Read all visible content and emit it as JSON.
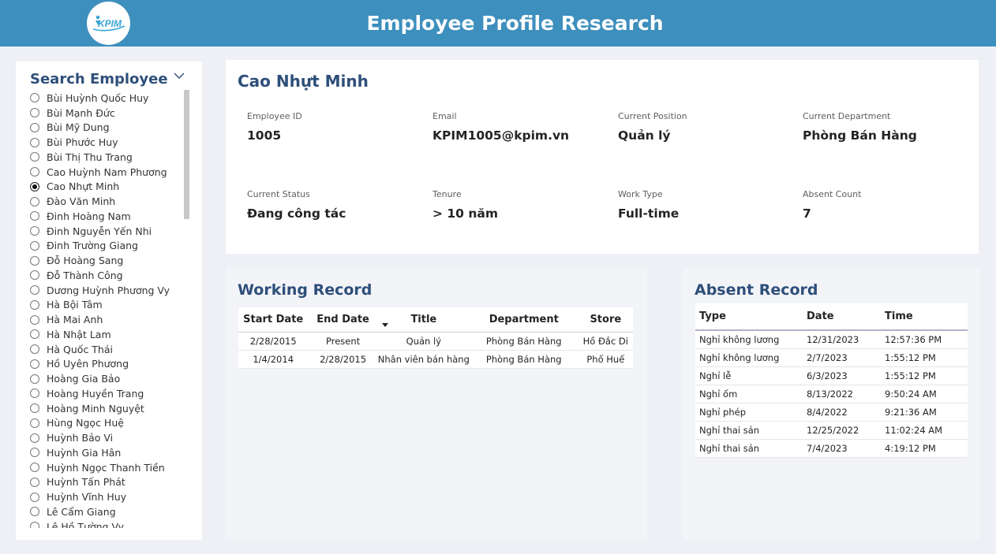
{
  "header": {
    "title": "Employee Profile Research",
    "logo_text": "KPIM",
    "bg_color": "#3d8fbd"
  },
  "slicer": {
    "title": "Search Employee",
    "selected": "Cao Nhựt Minh",
    "items": [
      "Bùi Huỳnh Quốc Huy",
      "Bùi Mạnh Đức",
      "Bùi Mỹ Dung",
      "Bùi Phước Huy",
      "Bùi Thị Thu Trang",
      "Cao Huỳnh Nam Phương",
      "Cao Nhựt Minh",
      "Đào Văn Minh",
      "Đinh Hoàng Nam",
      "Đinh Nguyễn Yến Nhi",
      "Đinh Trường Giang",
      "Đỗ Hoàng Sang",
      "Đỗ Thành Công",
      "Dương Huỳnh Phương Vy",
      "Hà Bội Tâm",
      "Hà Mai Anh",
      "Hà Nhật Lam",
      "Hà Quốc Thái",
      "Hồ Uyên Phương",
      "Hoàng Gia Bảo",
      "Hoàng Huyền Trang",
      "Hoàng Minh Nguyệt",
      "Hùng Ngọc Huệ",
      "Huỳnh Bảo Vi",
      "Huỳnh Gia Hân",
      "Huỳnh Ngọc Thanh Tiền",
      "Huỳnh Tấn Phát",
      "Huỳnh Vĩnh Huy",
      "Lê Cẩm Giang",
      "Lê Hồ Tường Vy"
    ]
  },
  "profile": {
    "name": "Cao Nhựt Minh",
    "fields": {
      "employee_id": {
        "label": "Employee ID",
        "value": "1005"
      },
      "email": {
        "label": "Email",
        "value": "KPIM1005@kpim.vn"
      },
      "position": {
        "label": "Current Position",
        "value": "Quản lý"
      },
      "department": {
        "label": "Current Department",
        "value": "Phòng Bán Hàng"
      },
      "status": {
        "label": "Current Status",
        "value": "Đang công tác"
      },
      "tenure": {
        "label": "Tenure",
        "value": "> 10 năm"
      },
      "work_type": {
        "label": "Work Type",
        "value": "Full-time"
      },
      "absent_count": {
        "label": "Absent Count",
        "value": "7"
      }
    }
  },
  "working_record": {
    "title": "Working Record",
    "columns": [
      "Start Date",
      "End Date",
      "Title",
      "Department",
      "Store"
    ],
    "sorted_column": "End Date",
    "rows": [
      [
        "2/28/2015",
        "Present",
        "Quản lý",
        "Phòng Bán Hàng",
        "Hồ Đắc Di"
      ],
      [
        "1/4/2014",
        "2/28/2015",
        "Nhân viên bán hàng",
        "Phòng Bán Hàng",
        "Phố Huế"
      ]
    ]
  },
  "absent_record": {
    "title": "Absent Record",
    "columns": [
      "Type",
      "Date",
      "Time"
    ],
    "rows": [
      [
        "Nghỉ không lương",
        "12/31/2023",
        "12:57:36 PM"
      ],
      [
        "Nghỉ không lương",
        "2/7/2023",
        "1:55:12 PM"
      ],
      [
        "Nghỉ lễ",
        "6/3/2023",
        "1:55:12 PM"
      ],
      [
        "Nghỉ ốm",
        "8/13/2022",
        "9:50:24 AM"
      ],
      [
        "Nghỉ phép",
        "8/4/2022",
        "9:21:36 AM"
      ],
      [
        "Nghỉ thai sản",
        "12/25/2022",
        "11:02:24 AM"
      ],
      [
        "Nghỉ thai sản",
        "7/4/2023",
        "4:19:12 PM"
      ]
    ]
  }
}
